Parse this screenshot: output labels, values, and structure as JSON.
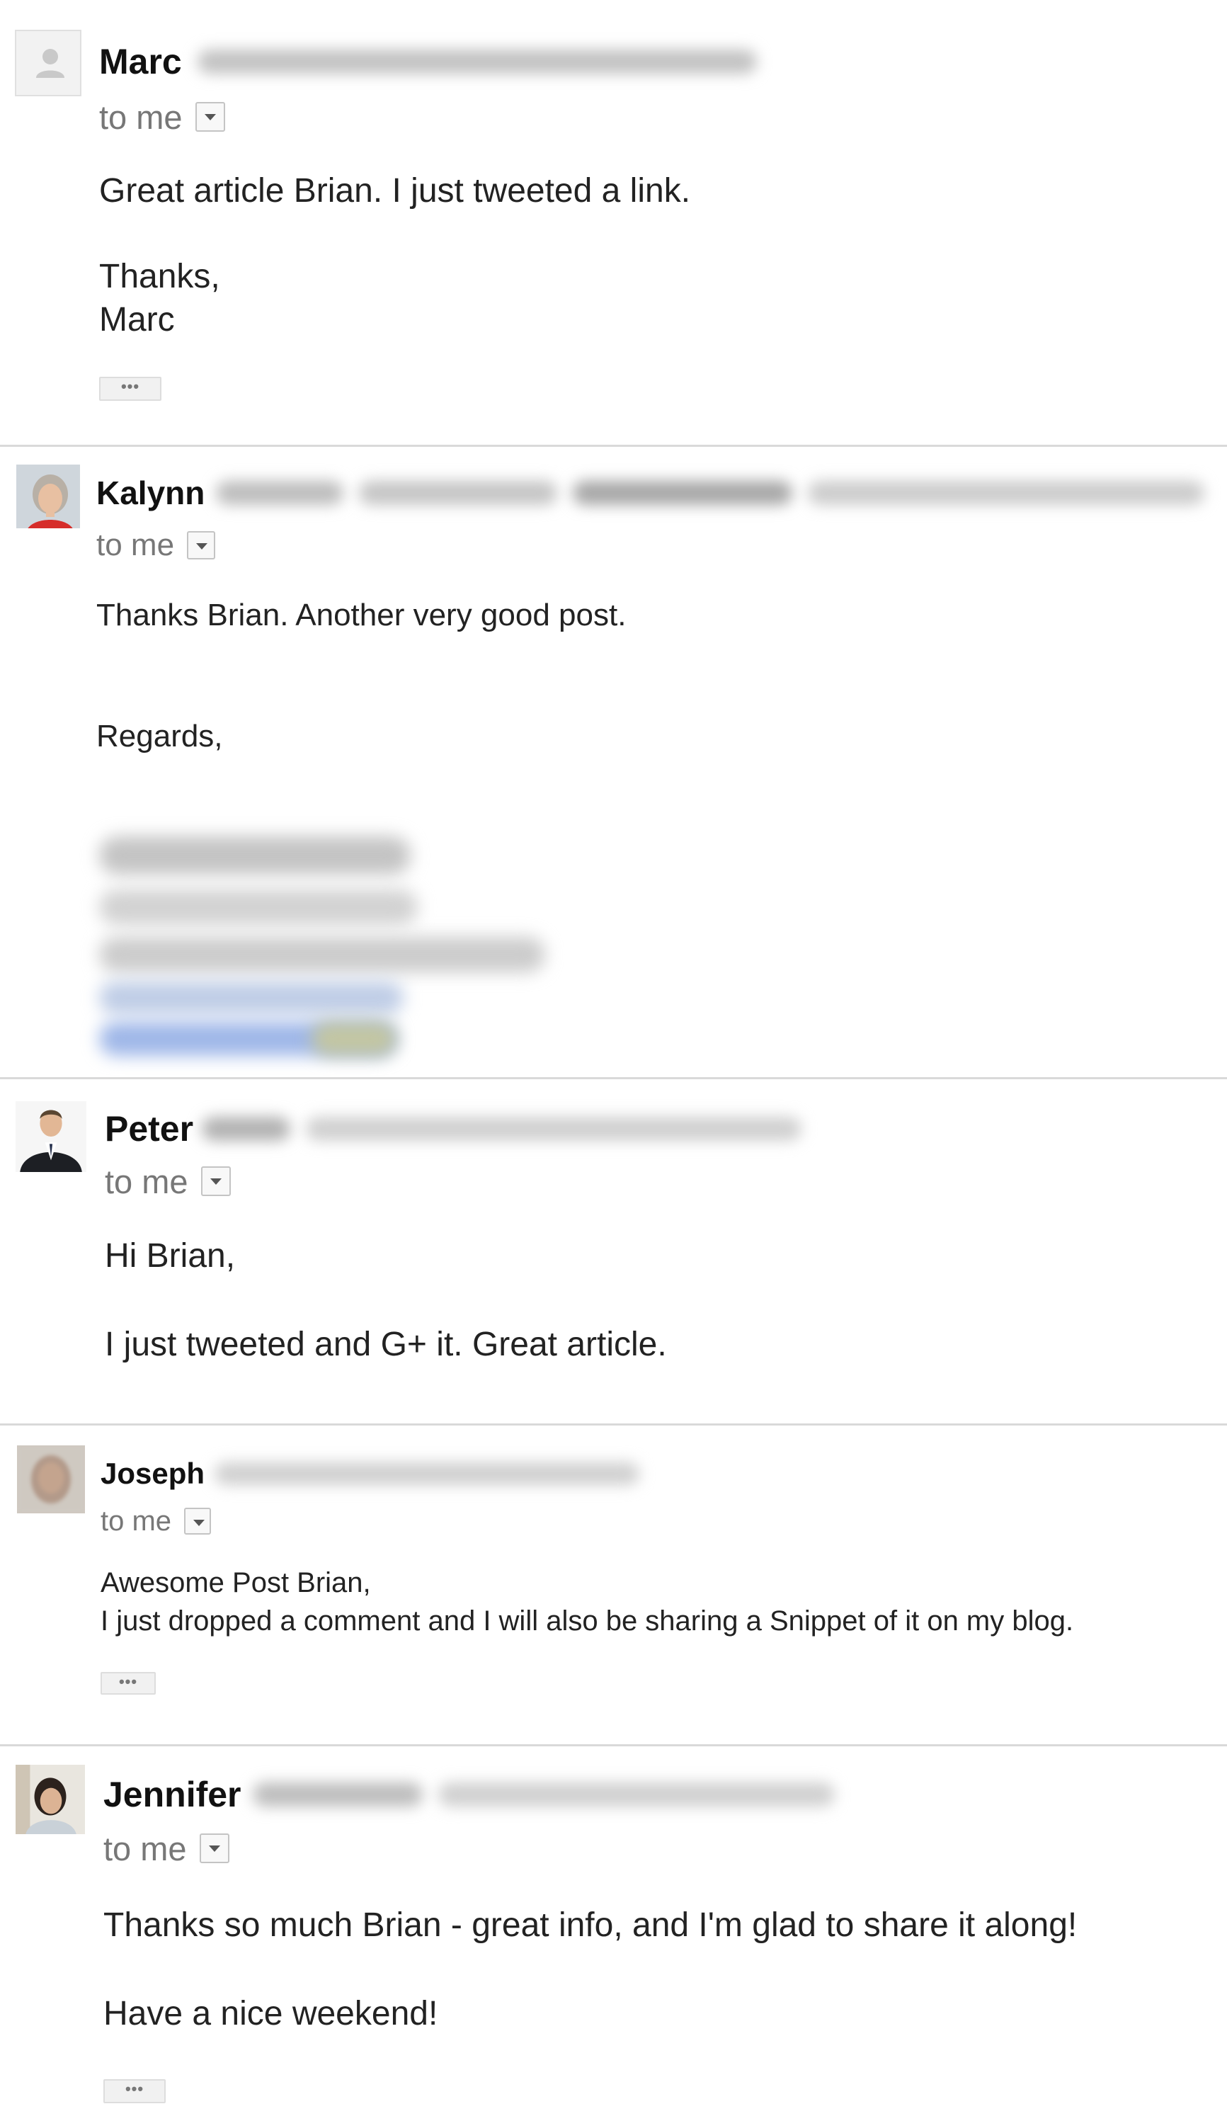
{
  "emails": [
    {
      "sender": "Marc",
      "recipient": "to me",
      "body": [
        "Great article Brian. I just tweeted a link.",
        "Thanks,",
        "Marc"
      ],
      "avatar_icon": "default-person-icon"
    },
    {
      "sender": "Kalynn",
      "recipient": "to me",
      "body": [
        "Thanks Brian. Another very good post.",
        "Regards,"
      ],
      "avatar_icon": "profile-photo"
    },
    {
      "sender": "Peter",
      "recipient": "to me",
      "body": [
        "Hi Brian,",
        "I just tweeted and G+ it. Great article."
      ],
      "avatar_icon": "profile-photo"
    },
    {
      "sender": "Joseph",
      "recipient": "to me",
      "body": [
        "Awesome Post Brian,",
        "I just dropped a comment and I will also be sharing a Snippet of it on my blog."
      ],
      "avatar_icon": "profile-photo"
    },
    {
      "sender": "Jennifer",
      "recipient": "to me",
      "body": [
        "Thanks so much Brian - great info, and I'm glad to share it along!",
        "Have a nice weekend!"
      ],
      "avatar_icon": "profile-photo"
    }
  ],
  "show_trimmed_label": "•••",
  "colors": {
    "divider": "#d9d9d9",
    "secondary_text": "#777777",
    "body_text": "#222222"
  }
}
